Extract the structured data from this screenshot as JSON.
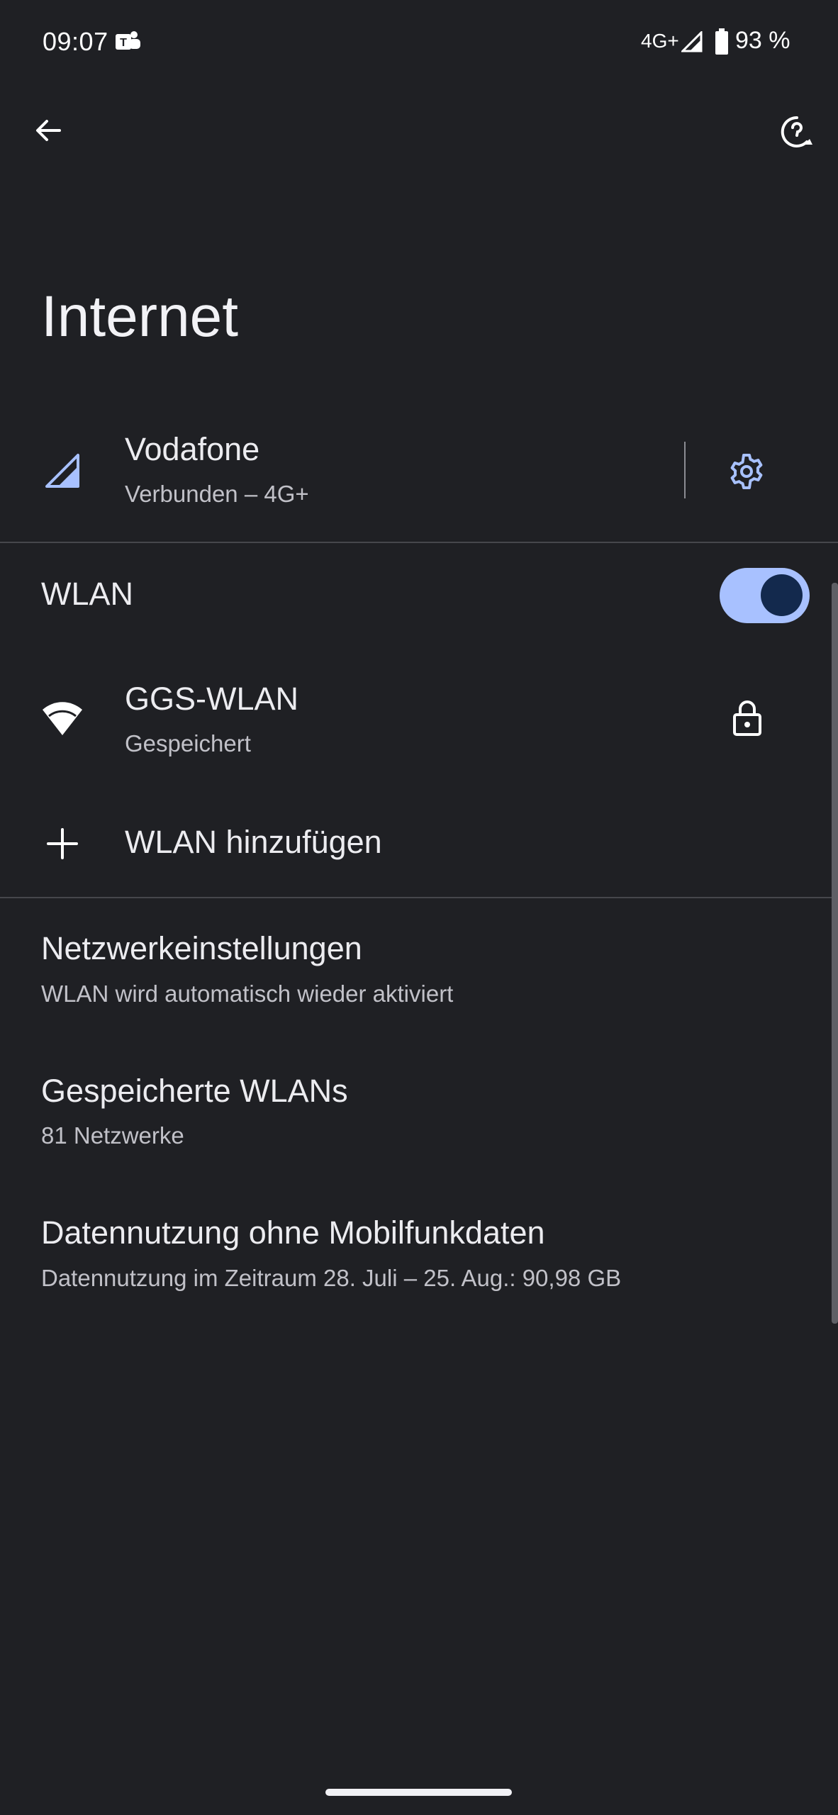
{
  "status_bar": {
    "time": "09:07",
    "network": "4G+",
    "battery": "93 %"
  },
  "title": "Internet",
  "mobile": {
    "name": "Vodafone",
    "status": "Verbunden – 4G+"
  },
  "wlan": {
    "label": "WLAN",
    "toggle_on": true,
    "network_name": "GGS-WLAN",
    "network_status": "Gespeichert",
    "add_label": "WLAN hinzufügen"
  },
  "settings": [
    {
      "title": "Netzwerkeinstellungen",
      "subtitle": "WLAN wird automatisch wieder aktiviert"
    },
    {
      "title": "Gespeicherte WLANs",
      "subtitle": "81 Netzwerke"
    },
    {
      "title": "Datennutzung ohne Mobilfunkdaten",
      "subtitle": "Datennutzung im Zeitraum 28. Juli – 25. Aug.: 90,98 GB"
    }
  ],
  "colors": {
    "background": "#1f2024",
    "accent": "#a8c1ff",
    "toggle_knob": "#13294d"
  },
  "icons": [
    "teams-icon",
    "signal-icon",
    "battery-icon",
    "back-icon",
    "help-icon",
    "cellular-signal-icon",
    "gear-icon",
    "wifi-icon",
    "lock-icon",
    "plus-icon"
  ]
}
